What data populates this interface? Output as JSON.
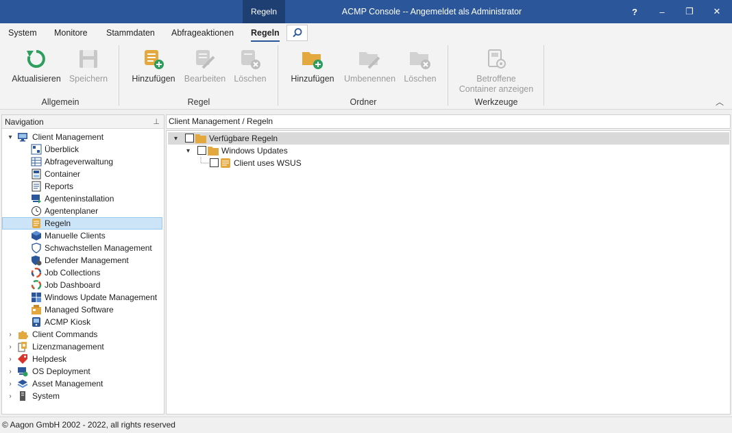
{
  "titlebar": {
    "context_tab": "Regeln",
    "title": "ACMP Console -- Angemeldet als Administrator",
    "help": "?",
    "minimize": "‒",
    "restore": "❐",
    "close": "✕"
  },
  "tabs": [
    "System",
    "Monitore",
    "Stammdaten",
    "Abfrageaktionen",
    "Regeln"
  ],
  "active_tab": "Regeln",
  "ribbon": {
    "groups": {
      "allgemein": "Allgemein",
      "regel": "Regel",
      "ordner": "Ordner",
      "werkzeuge": "Werkzeuge"
    },
    "buttons": {
      "aktualisieren": "Aktualisieren",
      "speichern": "Speichern",
      "regel_hinzufuegen": "Hinzufügen",
      "regel_bearbeiten": "Bearbeiten",
      "regel_loeschen": "Löschen",
      "ordner_hinzufuegen": "Hinzufügen",
      "ordner_umbenennen": "Umbenennen",
      "ordner_loeschen": "Löschen",
      "betroffene_line1": "Betroffene",
      "betroffene_line2": "Container anzeigen"
    }
  },
  "navigation": {
    "header": "Navigation",
    "client_management": "Client Management",
    "children": [
      "Überblick",
      "Abfrageverwaltung",
      "Container",
      "Reports",
      "Agenteninstallation",
      "Agentenplaner",
      "Regeln",
      "Manuelle Clients",
      "Schwachstellen Management",
      "Defender Management",
      "Job Collections",
      "Job Dashboard",
      "Windows Update Management",
      "Managed Software",
      "ACMP Kiosk"
    ],
    "selected": "Regeln",
    "roots": [
      "Client Commands",
      "Lizenzmanagement",
      "Helpdesk",
      "OS Deployment",
      "Asset Management",
      "System"
    ]
  },
  "breadcrumb": "Client Management / Regeln",
  "tree": {
    "root": "Verfügbare Regeln",
    "folder": "Windows Updates",
    "rule": "Client uses WSUS"
  },
  "status": "© Aagon GmbH 2002 - 2022, all rights reserved",
  "colors": {
    "titlebar": "#2b579a",
    "accent_green": "#2e9e5e",
    "folder": "#e3a93f",
    "selection": "#cce4f7"
  }
}
